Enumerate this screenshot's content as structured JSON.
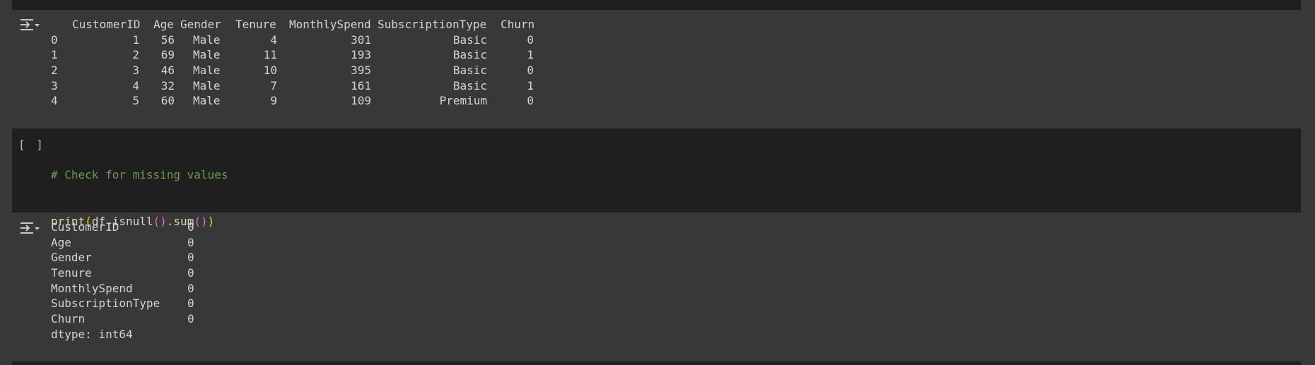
{
  "cells": {
    "code_cell": {
      "run_label": "[ ]",
      "comment": "# Check for missing values",
      "code_fn": "print",
      "code_open": "(",
      "code_obj": "df.isnull",
      "code_call1": "()",
      "code_dot": ".",
      "code_sum": "sum",
      "code_call2": "()",
      "code_close": ")"
    }
  },
  "dataframe_output": {
    "columns": [
      "CustomerID",
      "Age",
      "Gender",
      "Tenure",
      "MonthlySpend",
      "SubscriptionType",
      "Churn"
    ],
    "rows": [
      {
        "index": "0",
        "values": [
          "1",
          "56",
          "Male",
          "4",
          "301",
          "Basic",
          "0"
        ]
      },
      {
        "index": "1",
        "values": [
          "2",
          "69",
          "Male",
          "11",
          "193",
          "Basic",
          "1"
        ]
      },
      {
        "index": "2",
        "values": [
          "3",
          "46",
          "Male",
          "10",
          "395",
          "Basic",
          "0"
        ]
      },
      {
        "index": "3",
        "values": [
          "4",
          "32",
          "Male",
          "7",
          "161",
          "Basic",
          "1"
        ]
      },
      {
        "index": "4",
        "values": [
          "5",
          "60",
          "Male",
          "9",
          "109",
          "Premium",
          "0"
        ]
      }
    ]
  },
  "series_output": {
    "rows": [
      {
        "name": "CustomerID",
        "value": "0"
      },
      {
        "name": "Age",
        "value": "0"
      },
      {
        "name": "Gender",
        "value": "0"
      },
      {
        "name": "Tenure",
        "value": "0"
      },
      {
        "name": "MonthlySpend",
        "value": "0"
      },
      {
        "name": "SubscriptionType",
        "value": "0"
      },
      {
        "name": "Churn",
        "value": "0"
      }
    ],
    "dtype": "dtype: int64"
  },
  "icons": {
    "output_toggle": "output-toggle-icon"
  },
  "colors": {
    "background": "#383838",
    "code_background": "#1f1f1f",
    "comment": "#6a9955",
    "function": "#dcdcaa",
    "paren_outer": "#ffd700",
    "paren_inner": "#da70d6"
  }
}
